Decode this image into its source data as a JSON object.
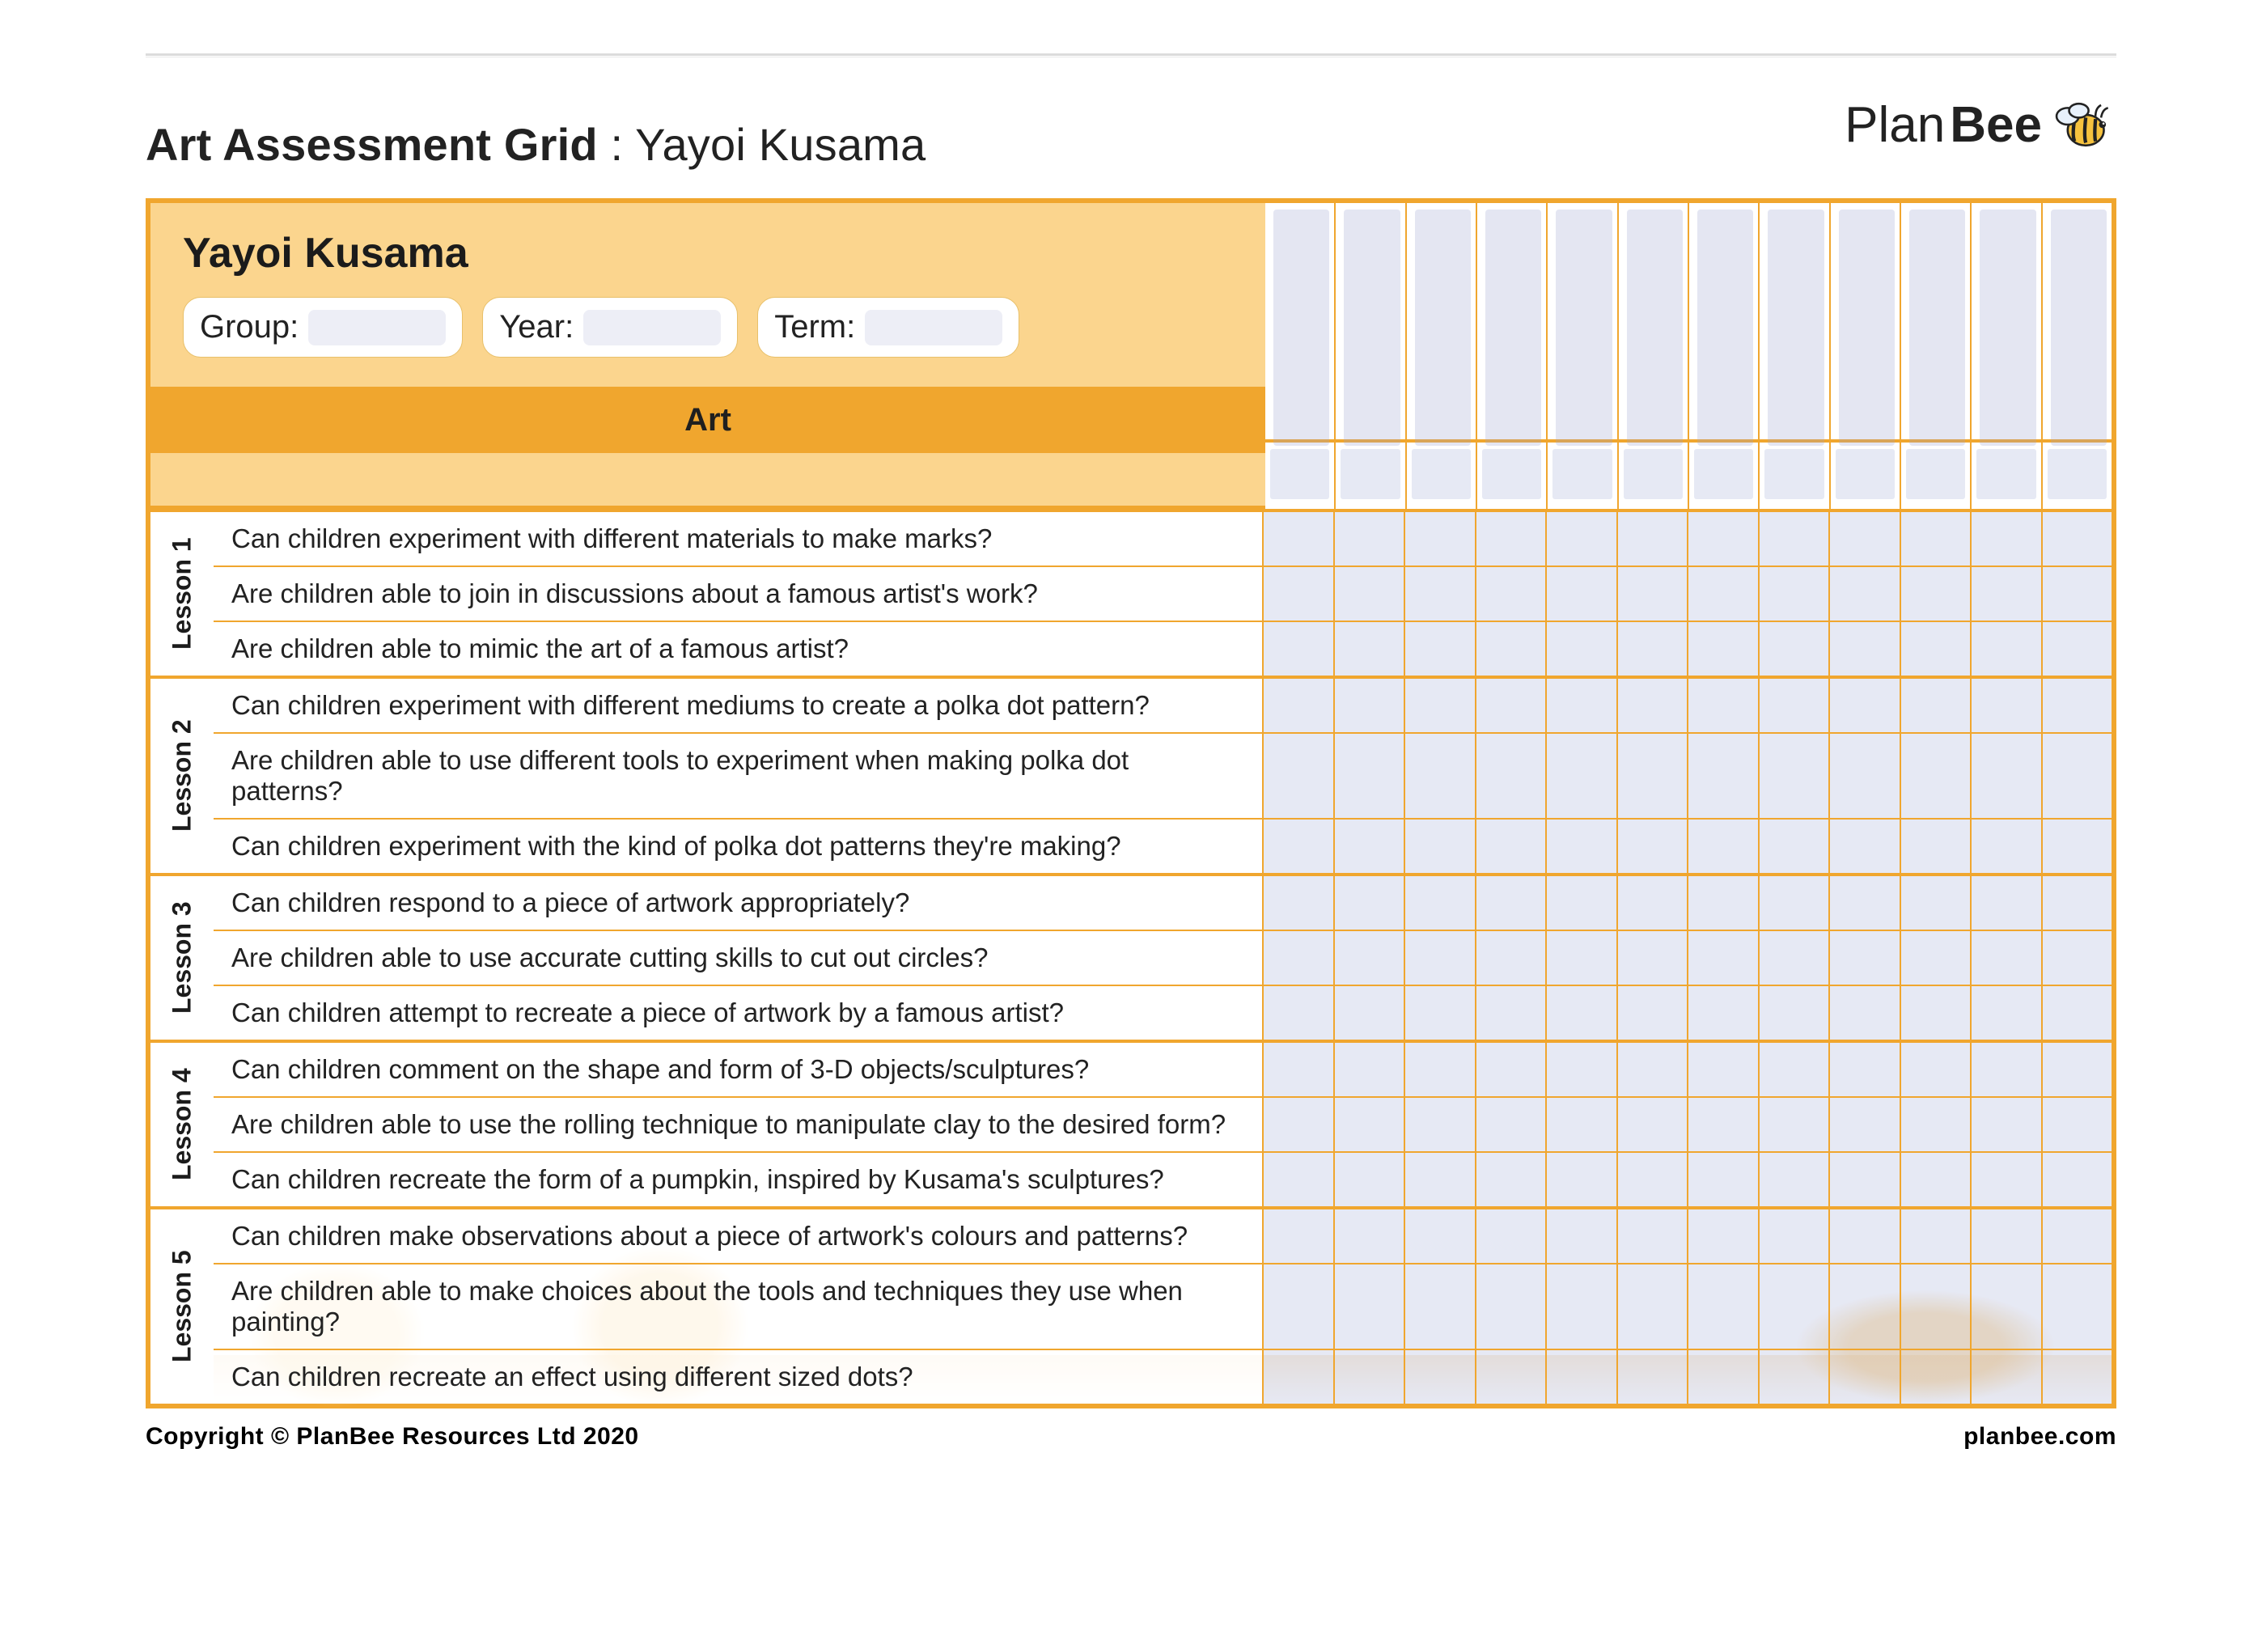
{
  "brand": {
    "name_light": "Plan",
    "name_bold": "Bee"
  },
  "title": {
    "prefix": "Art Assessment Grid",
    "sep": " : ",
    "topic": "Yayoi Kusama"
  },
  "header": {
    "topic_title": "Yayoi Kusama",
    "fields": {
      "group_label": "Group:",
      "year_label": "Year:",
      "term_label": "Term:"
    },
    "subject": "Art"
  },
  "student_columns": 12,
  "lessons": [
    {
      "label": "Lesson 1",
      "questions": [
        "Can children experiment with different materials to make marks?",
        "Are children able to join in discussions about a famous artist's work?",
        "Are children able to mimic the art of a famous artist?"
      ]
    },
    {
      "label": "Lesson 2",
      "questions": [
        "Can children experiment with different mediums to create a polka dot pattern?",
        "Are children able to use different tools to experiment when making polka dot patterns?",
        "Can children experiment with the kind of polka dot patterns they're making?"
      ]
    },
    {
      "label": "Lesson 3",
      "questions": [
        "Can children respond to a piece of artwork appropriately?",
        "Are children able to use accurate cutting skills to cut out circles?",
        "Can children attempt to recreate a piece of artwork by a famous artist?"
      ]
    },
    {
      "label": "Lesson 4",
      "questions": [
        "Can children comment on the shape and form of 3-D objects/sculptures?",
        "Are children able to use the rolling technique to manipulate clay to the desired form?",
        "Can children recreate the form of a pumpkin, inspired by Kusama's sculptures?"
      ]
    },
    {
      "label": "Lesson 5",
      "questions": [
        "Can children make observations about a piece of artwork's colours and patterns?",
        "Are children able to make choices about the tools and techniques they use when painting?",
        "Can children recreate an effect using different sized dots?"
      ]
    }
  ],
  "footer": {
    "copyright": "Copyright © PlanBee Resources Ltd 2020",
    "site": "planbee.com"
  }
}
